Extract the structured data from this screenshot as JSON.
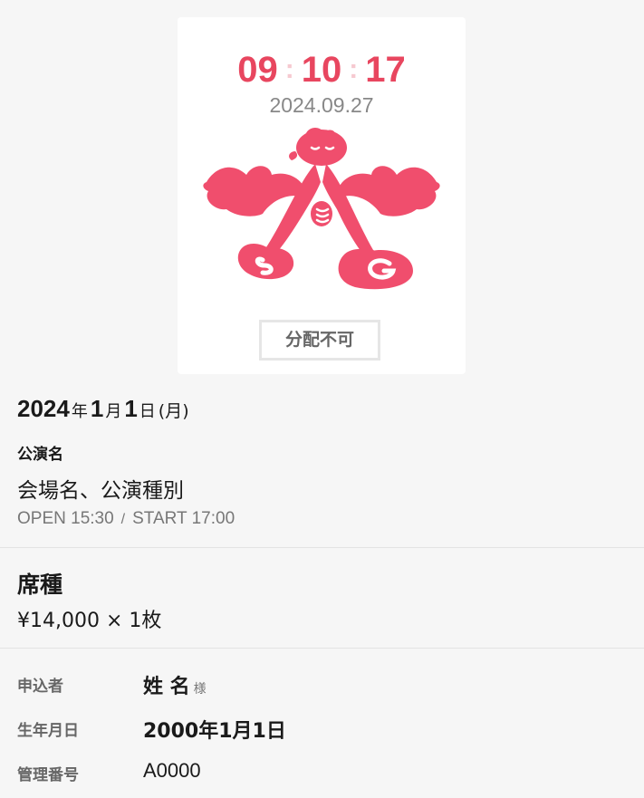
{
  "ticket": {
    "clock": {
      "hours": "09",
      "minutes": "10",
      "seconds": "17"
    },
    "date": "2024.09.27",
    "logo_icon": "angel-logo-icon",
    "status_label": "分配不可",
    "accent_color": "#e8465f"
  },
  "event": {
    "year": "2024",
    "year_unit": "年",
    "month": "1",
    "month_unit": "月",
    "day": "1",
    "day_unit": "日",
    "weekday": "(月)",
    "performance_label": "公演名",
    "venue_text": "会場名、公演種別",
    "open_time": "OPEN 15:30",
    "time_separator": "/",
    "start_time": "START 17:00"
  },
  "seat": {
    "type": "席種",
    "price": "¥14,000 × 1枚"
  },
  "applicant": {
    "name_label": "申込者",
    "name_value": "姓 名",
    "honorific": "様",
    "birth_label": "生年月日",
    "birth_value": "2000年1月1日",
    "id_label": "管理番号",
    "id_value": "A0000"
  }
}
